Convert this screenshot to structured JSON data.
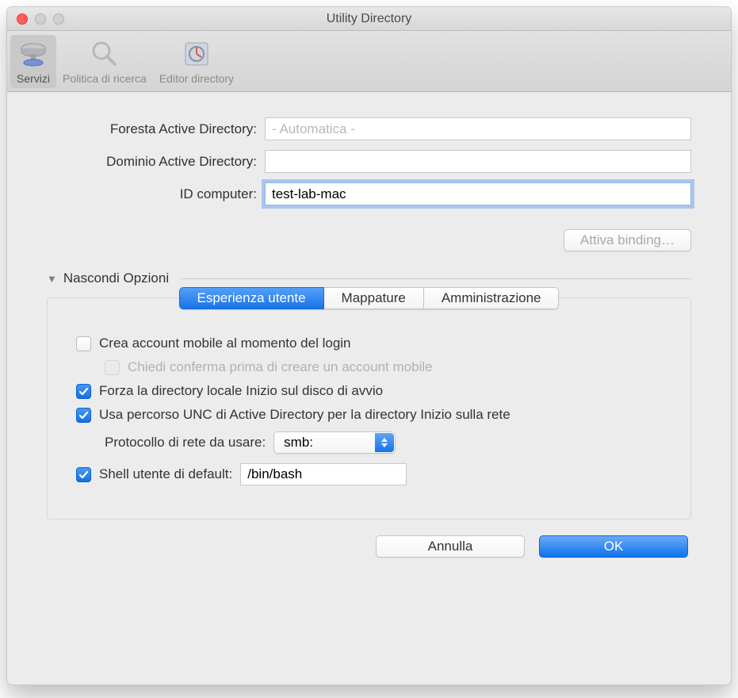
{
  "window": {
    "title": "Utility Directory"
  },
  "toolbar": {
    "items": [
      {
        "label": "Servizi"
      },
      {
        "label": "Politica di ricerca"
      },
      {
        "label": "Editor directory"
      }
    ]
  },
  "form": {
    "forest_label": "Foresta Active Directory:",
    "forest_placeholder": "- Automatica -",
    "forest_value": "",
    "domain_label": "Dominio Active Directory:",
    "domain_value": "",
    "computer_id_label": "ID computer:",
    "computer_id_value": "test-lab-mac",
    "bind_button": "Attiva binding…"
  },
  "disclosure": {
    "label": "Nascondi Opzioni"
  },
  "tabs": {
    "items": [
      {
        "label": "Esperienza utente"
      },
      {
        "label": "Mappature"
      },
      {
        "label": "Amministrazione"
      }
    ]
  },
  "options": {
    "create_mobile": "Crea account mobile al momento del login",
    "ask_confirm": "Chiedi conferma prima di creare un account mobile",
    "force_local": "Forza la directory locale Inizio sul disco di avvio",
    "use_unc": "Usa percorso UNC di Active Directory per la directory Inizio sulla rete",
    "protocol_label": "Protocollo di rete da usare:",
    "protocol_value": "smb:",
    "default_shell_label": "Shell utente di default:",
    "default_shell_value": "/bin/bash"
  },
  "footer": {
    "cancel": "Annulla",
    "ok": "OK"
  }
}
